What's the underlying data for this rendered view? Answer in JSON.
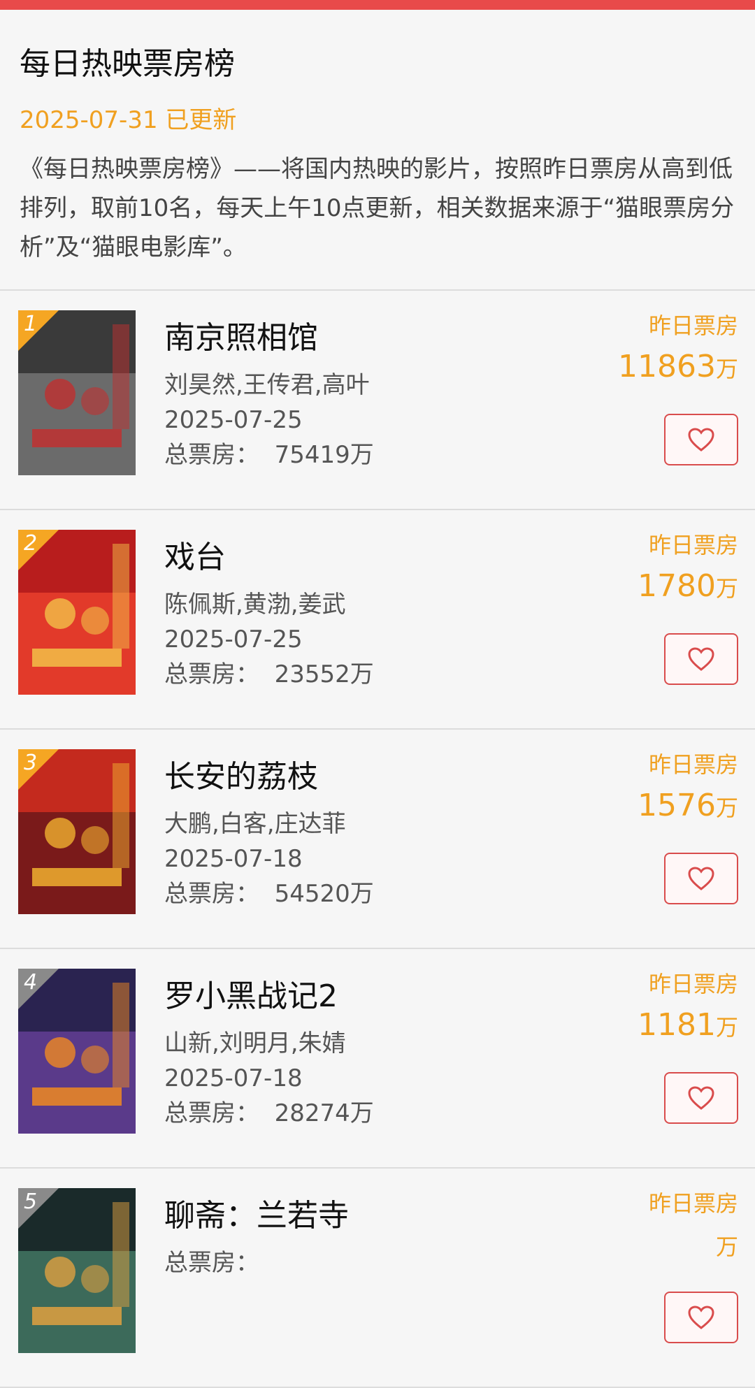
{
  "page": {
    "title": "每日热映票房榜",
    "updated": "2025-07-31 已更新",
    "description": "《每日热映票房榜》——将国内热映的影片，按照昨日票房从高到低排列，取前10名，每天上午10点更新，相关数据来源于“猫眼票房分析”及“猫眼电影库”。"
  },
  "colors": {
    "accent": "#f0a020",
    "topbar": "#e84a4a",
    "button_border": "#d94c4c"
  },
  "list": {
    "yesterday_label": "昨日票房",
    "unit": "万",
    "total_prefix": "总票房："
  },
  "movies": [
    {
      "rank": "1",
      "title": "南京照相馆",
      "cast": "刘昊然,王传君,高叶",
      "date": "2025-07-25",
      "total": "75419万",
      "yesterday": "11863",
      "poster_palette": [
        "#3a3a3a",
        "#6b6b6b",
        "#c03030"
      ]
    },
    {
      "rank": "2",
      "title": "戏台",
      "cast": "陈佩斯,黄渤,姜武",
      "date": "2025-07-25",
      "total": "23552万",
      "yesterday": "1780",
      "poster_palette": [
        "#b81d1d",
        "#e23a2a",
        "#f2c048"
      ]
    },
    {
      "rank": "3",
      "title": "长安的荔枝",
      "cast": "大鹏,白客,庄达菲",
      "date": "2025-07-18",
      "total": "54520万",
      "yesterday": "1576",
      "poster_palette": [
        "#c42a1e",
        "#7a1a1a",
        "#f0b030"
      ]
    },
    {
      "rank": "4",
      "title": "罗小黑战记2",
      "cast": "山新,刘明月,朱婧",
      "date": "2025-07-18",
      "total": "28274万",
      "yesterday": "1181",
      "poster_palette": [
        "#2a2350",
        "#5a3a8a",
        "#f08a20"
      ]
    },
    {
      "rank": "5",
      "title": "聊斋：兰若寺",
      "cast": "",
      "date": "",
      "total": "",
      "yesterday": "",
      "poster_palette": [
        "#1a2a2a",
        "#3c6a5a",
        "#e0a040"
      ]
    }
  ]
}
